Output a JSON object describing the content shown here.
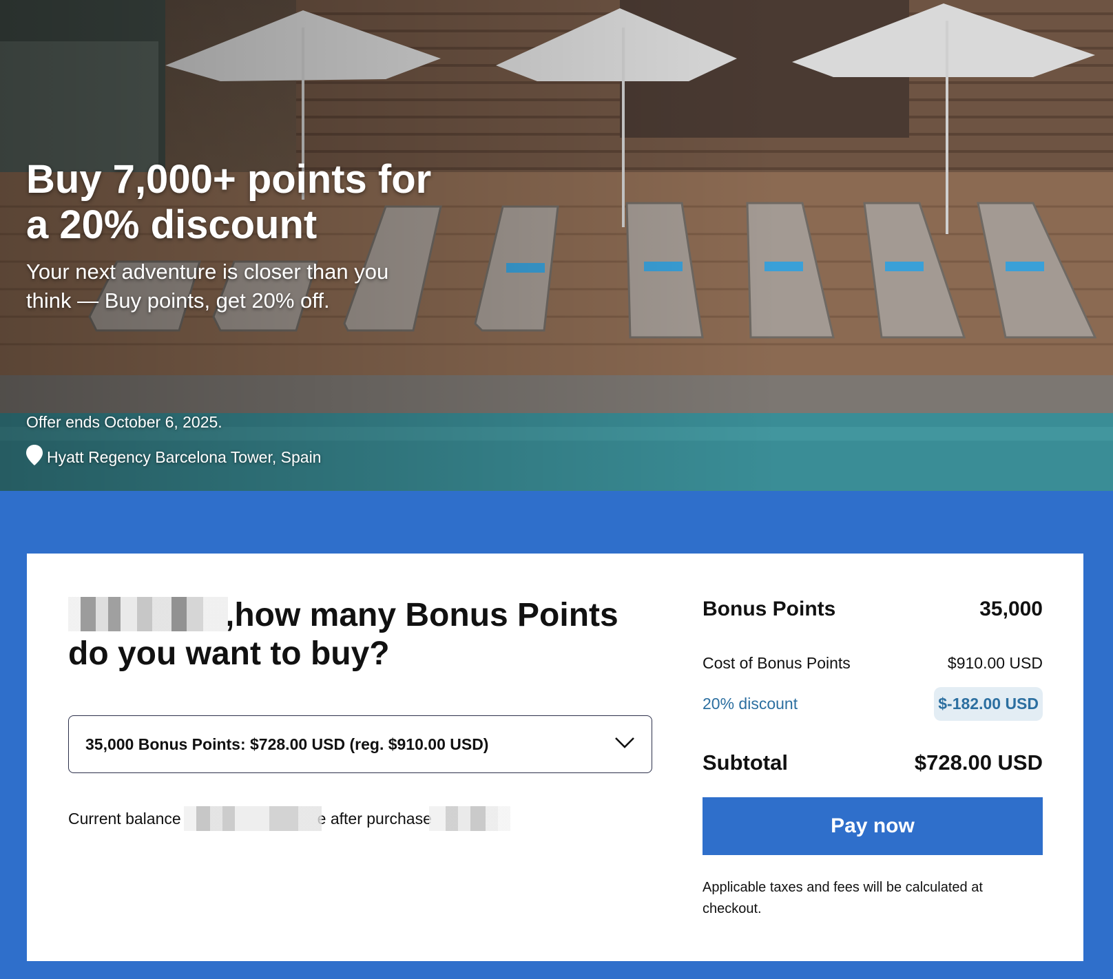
{
  "hero": {
    "title": "Buy 7,000+ points for a 20% discount",
    "subtitle": "Your next adventure is closer than you think — Buy points, get 20% off.",
    "offer_ends": "Offer ends October 6, 2025.",
    "location": "Hyatt Regency Barcelona Tower, Spain",
    "location_icon": "map-pin-icon"
  },
  "purchase": {
    "question": "how many Bonus Points do you want to buy?",
    "question_prefix": ",",
    "select_value": "35,000 Bonus Points: $728.00 USD (reg. $910.00 USD)",
    "balance_label": "Current balance",
    "balance_after_label": "e after purchase"
  },
  "summary": {
    "points_label": "Bonus Points",
    "points_value": "35,000",
    "cost_label": "Cost of Bonus Points",
    "cost_value": "$910.00 USD",
    "discount_label": "20% discount",
    "discount_value": "$-182.00 USD",
    "subtotal_label": "Subtotal",
    "subtotal_value": "$728.00 USD",
    "pay_button": "Pay now",
    "taxes_note": "Applicable taxes and fees will be calculated at checkout."
  },
  "colors": {
    "brand_blue": "#2f6fcb",
    "discount_text": "#2c6fa0",
    "discount_bg": "#e3edf4"
  }
}
